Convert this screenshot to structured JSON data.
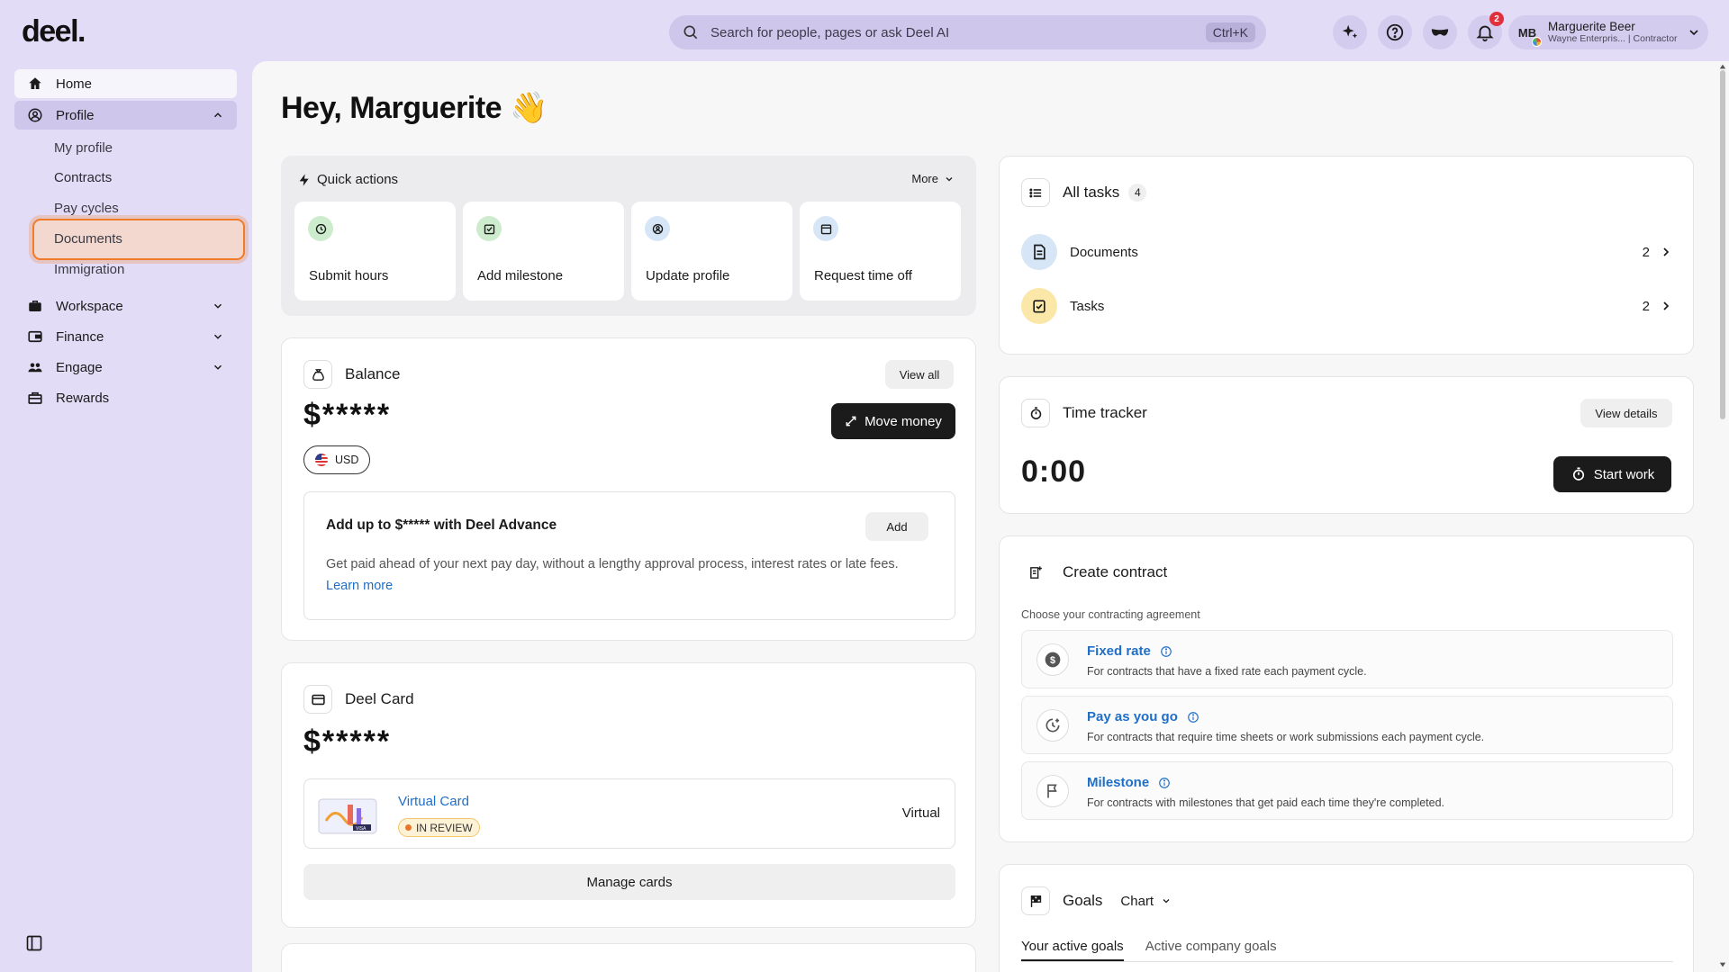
{
  "brand": {
    "logo": "deel."
  },
  "search": {
    "placeholder": "Search for people, pages or ask Deel AI",
    "shortcut": "Ctrl+K"
  },
  "topbar": {
    "notification_count": "2"
  },
  "user": {
    "initials": "MB",
    "name": "Marguerite Beer",
    "subtitle": "Wayne Enterpris... | Contractor"
  },
  "sidebar": {
    "home": "Home",
    "profile": "Profile",
    "profile_sub": [
      "My profile",
      "Contracts",
      "Pay cycles",
      "Documents",
      "Immigration"
    ],
    "workspace": "Workspace",
    "finance": "Finance",
    "engage": "Engage",
    "rewards": "Rewards"
  },
  "main": {
    "greeting": "Hey, Marguerite 👋",
    "quick_actions": {
      "title": "Quick actions",
      "more": "More",
      "tiles": [
        "Submit hours",
        "Add milestone",
        "Update profile",
        "Request time off"
      ]
    },
    "balance": {
      "title": "Balance",
      "view_all": "View all",
      "amount": "$*****",
      "move_money": "Move money",
      "currency": "USD",
      "advance_title": "Add up to $***** with Deel Advance",
      "advance_add": "Add",
      "advance_desc": "Get paid ahead of your next pay day, without a lengthy approval process, interest rates or late fees.",
      "learn_more": "Learn more"
    },
    "deel_card": {
      "title": "Deel Card",
      "amount": "$*****",
      "card_name": "Virtual Card",
      "card_status": "IN REVIEW",
      "card_type": "Virtual",
      "manage": "Manage cards"
    },
    "tasks": {
      "title": "All tasks",
      "count": "4",
      "rows": [
        {
          "label": "Documents",
          "count": "2"
        },
        {
          "label": "Tasks",
          "count": "2"
        }
      ]
    },
    "time_tracker": {
      "title": "Time tracker",
      "view_details": "View details",
      "time": "0:00",
      "start": "Start work"
    },
    "create_contract": {
      "title": "Create contract",
      "subtitle": "Choose your contracting agreement",
      "options": [
        {
          "title": "Fixed rate",
          "desc": "For contracts that have a fixed rate each payment cycle."
        },
        {
          "title": "Pay as you go",
          "desc": "For contracts that require time sheets or work submissions each payment cycle."
        },
        {
          "title": "Milestone",
          "desc": "For contracts with milestones that get paid each time they're completed."
        }
      ]
    },
    "goals": {
      "title": "Goals",
      "view": "Chart",
      "tabs": [
        "Your active goals",
        "Active company goals"
      ]
    }
  },
  "colors": {
    "accent": "#f07b28",
    "link": "#1f6fc6",
    "topbar_bg": "#e3dcf6"
  }
}
